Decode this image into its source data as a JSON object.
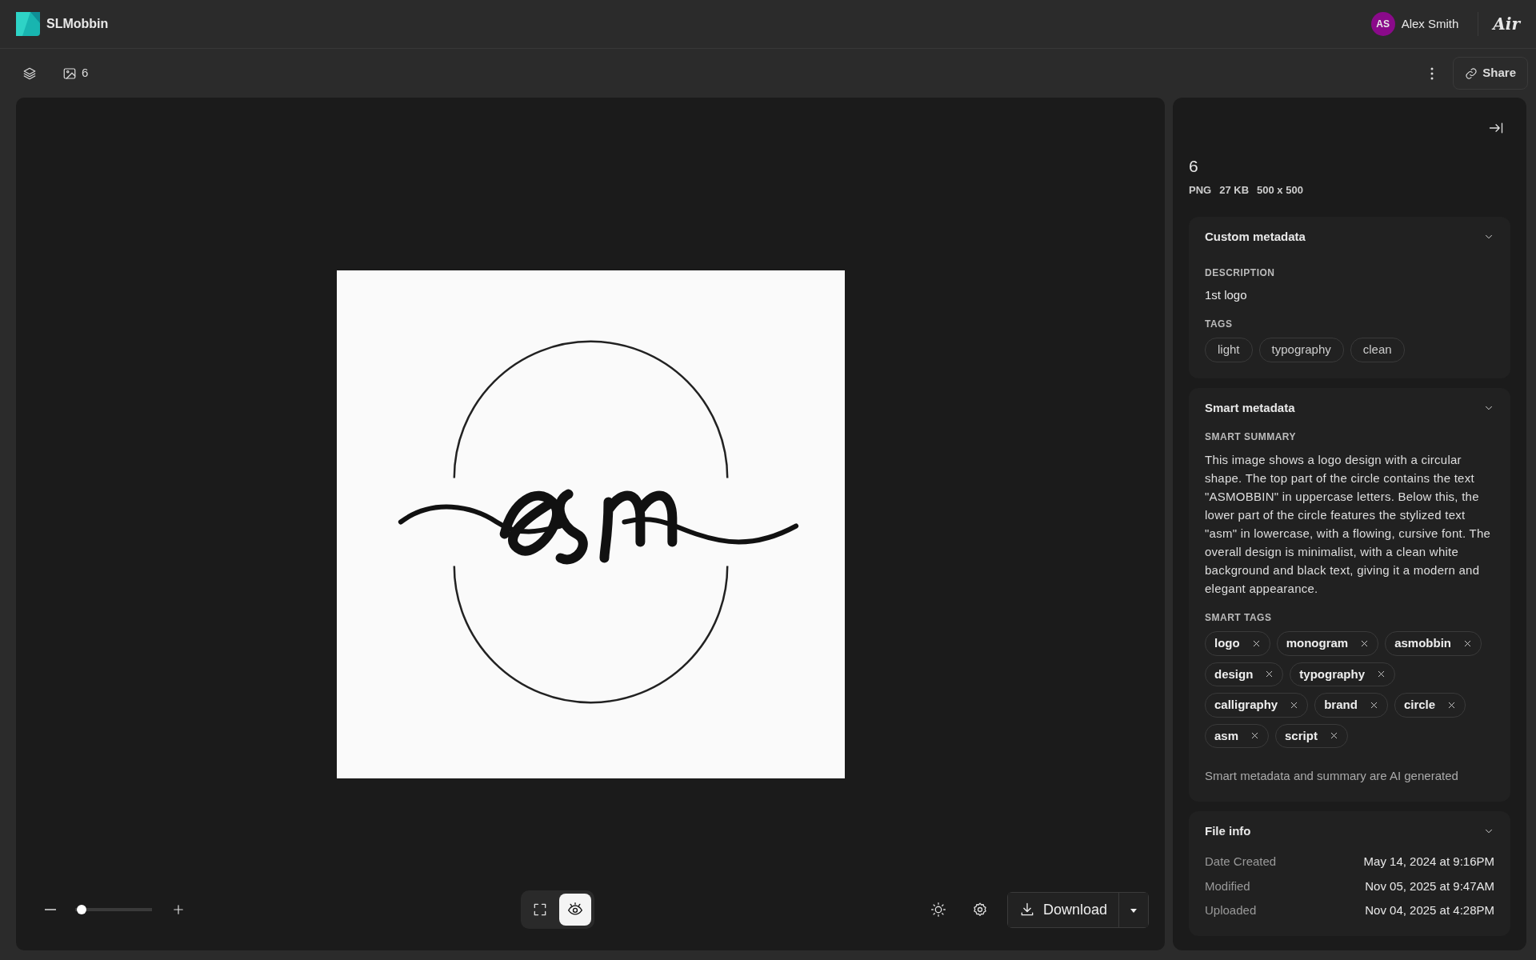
{
  "header": {
    "app_name": "SLMobbin",
    "user": {
      "initials": "AS",
      "name": "Alex Smith"
    },
    "brand": "Air"
  },
  "toolbar": {
    "image_count": "6",
    "share": "Share"
  },
  "viewer": {
    "zoom": {
      "level": 0.02
    },
    "view_modes": [
      {
        "kind": "fullscreen",
        "selected": false
      },
      {
        "kind": "eye",
        "selected": true
      }
    ],
    "download": "Download"
  },
  "panel": {
    "title": "6",
    "meta": [
      "PNG",
      "27 KB",
      "500 x 500"
    ],
    "sections": [
      {
        "kind": "custom",
        "title": "Custom metadata",
        "expanded": true,
        "description_label": "DESCRIPTION",
        "description": "1st logo",
        "tags_label": "TAGS",
        "tags": [
          "light",
          "typography",
          "clean"
        ]
      },
      {
        "kind": "smart",
        "title": "Smart metadata",
        "expanded": true,
        "summary_label": "SMART SUMMARY",
        "summary": "This image shows a logo design with a circular shape. The top part of the circle contains the text \"ASMOBBIN\" in uppercase letters. Below this, the lower part of the circle features the stylized text \"asm\" in lowercase, with a flowing, cursive font. The overall design is minimalist, with a clean white background and black text, giving it a modern and elegant appearance.",
        "tags_label": "SMART TAGS",
        "tags": [
          "logo",
          "monogram",
          "asmobbin",
          "design",
          "typography",
          "calligraphy",
          "brand",
          "circle",
          "asm",
          "script"
        ],
        "note": "Smart metadata and summary are AI generated"
      },
      {
        "kind": "fileinfo",
        "title": "File info",
        "expanded": true,
        "rows": [
          {
            "label": "Date Created",
            "value": "May 14, 2024 at 9:16PM"
          },
          {
            "label": "Modified",
            "value": "Nov 05, 2025 at 9:47AM"
          },
          {
            "label": "Uploaded",
            "value": "Nov 04, 2025 at 4:28PM"
          }
        ]
      }
    ]
  }
}
